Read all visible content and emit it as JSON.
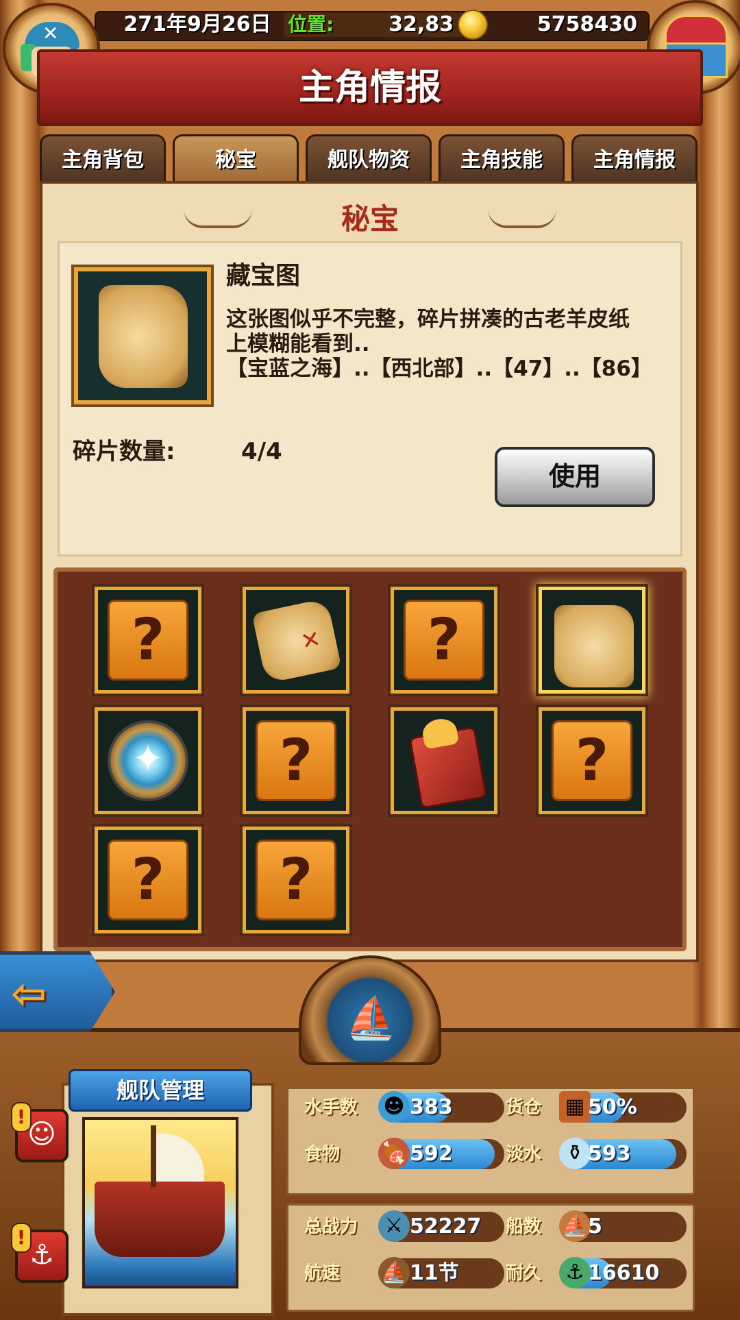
{
  "status_bar": {
    "date": "271年9月26日",
    "position_label": "位置:",
    "position_value": "32,83",
    "gold": "5758430"
  },
  "header": {
    "title": "主角情报"
  },
  "tabs": [
    {
      "label": "主角背包",
      "active": false
    },
    {
      "label": "秘宝",
      "active": true
    },
    {
      "label": "舰队物资",
      "active": false
    },
    {
      "label": "主角技能",
      "active": false
    },
    {
      "label": "主角情报",
      "active": false
    }
  ],
  "section": {
    "title": "秘宝"
  },
  "detail": {
    "name": "藏宝图",
    "description_line1": "这张图似乎不完整，碎片拼凑的古老羊皮纸",
    "description_line2": "上模糊能看到..",
    "description_line3": "【宝蓝之海】..【西北部】..【47】..【86】",
    "fragment_label": "碎片数量:",
    "fragment_value": "4/4",
    "use_button": "使用"
  },
  "treasure_slots": [
    {
      "icon": "question-mark-icon",
      "unknown": true,
      "glyph": "?"
    },
    {
      "icon": "treasure-map-fragment-icon",
      "unknown": false
    },
    {
      "icon": "question-mark-icon",
      "unknown": true,
      "glyph": "?"
    },
    {
      "icon": "treasure-map-icon",
      "unknown": false,
      "selected": true
    },
    {
      "icon": "compass-icon",
      "unknown": false
    },
    {
      "icon": "question-mark-icon",
      "unknown": true,
      "glyph": "?"
    },
    {
      "icon": "red-book-icon",
      "unknown": false
    },
    {
      "icon": "question-mark-icon",
      "unknown": true,
      "glyph": "?"
    },
    {
      "icon": "question-mark-icon",
      "unknown": true,
      "glyph": "?"
    },
    {
      "icon": "question-mark-icon",
      "unknown": true,
      "glyph": "?"
    }
  ],
  "fleet": {
    "title": "舰队管理",
    "stats": [
      {
        "label": "水手数",
        "value": "383",
        "icon": "sailor-icon",
        "fill": 0.55
      },
      {
        "label": "货仓",
        "value": "50%",
        "icon": "crate-icon",
        "fill": 0.5
      },
      {
        "label": "食物",
        "value": "592",
        "icon": "meat-icon",
        "fill": 0.92
      },
      {
        "label": "淡水",
        "value": "593",
        "icon": "water-jug-icon",
        "fill": 0.92
      },
      {
        "label": "总战力",
        "value": "52227",
        "icon": "crossed-swords-skull-icon",
        "fill": 0
      },
      {
        "label": "船数",
        "value": "5",
        "icon": "ship-icon",
        "fill": 0
      },
      {
        "label": "航速",
        "value": "11节",
        "icon": "sail-speed-icon",
        "fill": 0
      },
      {
        "label": "耐久",
        "value": "16610",
        "icon": "anchor-durability-icon",
        "fill": 0.4
      }
    ]
  },
  "colors": {
    "banner": "#a0241f",
    "accent_gold": "#e9a83a",
    "stat_fill": "#2c87d0",
    "position_label": "#63e32b"
  }
}
